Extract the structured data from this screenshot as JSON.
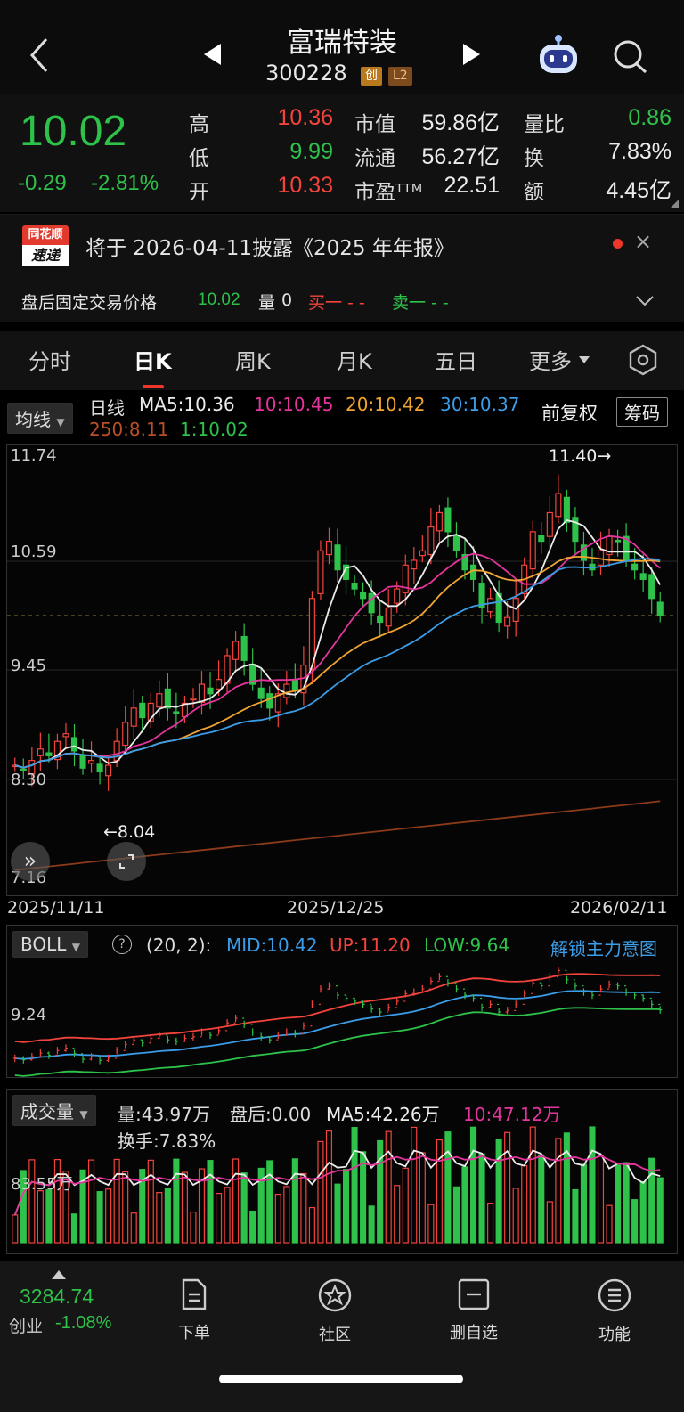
{
  "header": {
    "title": "富瑞特装",
    "code": "300228",
    "badge_board": "创",
    "badge_level": "L2"
  },
  "quote": {
    "price": "10.02",
    "change": "-0.29",
    "change_pct": "-2.81%",
    "high_label": "高",
    "high": "10.36",
    "low_label": "低",
    "low": "9.99",
    "open_label": "开",
    "open": "10.33",
    "mcap_label": "市值",
    "mcap": "59.86亿",
    "float_label": "流通",
    "float": "56.27亿",
    "pe_label": "市盈ᵀᵀᴹ",
    "pe": "22.51",
    "vol_ratio_label": "量比",
    "vol_ratio": "0.86",
    "turnover_label": "换",
    "turnover": "7.83%",
    "amount_label": "额",
    "amount": "4.45亿"
  },
  "notice": {
    "logo_top": "同花顺",
    "logo_bottom": "速递",
    "text": "将于 2026-04-11披露《2025 年年报》",
    "close": "×"
  },
  "after_hours": {
    "label": "盘后固定交易价格",
    "price": "10.02",
    "vol_label": "量",
    "vol": "0",
    "buy": "买一 - -",
    "sell": "卖一 - -"
  },
  "tabs": [
    "分时",
    "日K",
    "周K",
    "月K",
    "五日",
    "更多"
  ],
  "active_tab": 1,
  "kline": {
    "ma_button": "均线",
    "series_label": "日线",
    "ma5": "MA5:10.36",
    "ma10": "10:10.45",
    "ma20": "20:10.42",
    "ma30": "30:10.37",
    "ma250": "250:8.11",
    "ma1": "1:10.02",
    "adjust": "前复权",
    "chip": "筹码",
    "price_ticks": [
      "11.74",
      "10.59",
      "9.45",
      "8.30",
      "7.16"
    ],
    "high_marker": "11.40→",
    "low_marker": "←8.04",
    "dates": [
      "2025/11/11",
      "2025/12/25",
      "2026/02/11"
    ],
    "colors": {
      "ma5": "#ececec",
      "ma10": "#e4359d",
      "ma20": "#f0a431",
      "ma30": "#3b9de8",
      "ma250": "#8b3a1a",
      "ma1": "#2ec24a"
    }
  },
  "boll": {
    "button": "BOLL",
    "params": "(20, 2):",
    "mid": "MID:10.42",
    "up": "UP:11.20",
    "low": "LOW:9.64",
    "unlock": "解锁主力意图",
    "tick": "9.24"
  },
  "volume": {
    "button": "成交量",
    "vol": "量:43.97万",
    "after": "盘后:0.00",
    "ma5": "MA5:42.26万",
    "ma10": "10:47.12万",
    "turnover": "换手:7.83%",
    "tick": "83.55万"
  },
  "nav": {
    "index_value": "3284.74",
    "index_name": "创业",
    "index_change": "-1.08%",
    "order": "下单",
    "community": "社区",
    "watchlist": "删自选",
    "functions": "功能"
  },
  "chart_data": {
    "type": "candlestick",
    "title": "",
    "ylim": [
      7.16,
      11.74
    ],
    "close_series": [
      8.45,
      8.4,
      8.5,
      8.62,
      8.55,
      8.7,
      8.78,
      8.6,
      8.42,
      8.5,
      8.38,
      8.45,
      8.7,
      8.9,
      9.05,
      8.95,
      9.1,
      9.2,
      9.05,
      9.0,
      9.1,
      9.15,
      9.3,
      9.2,
      9.35,
      9.6,
      9.75,
      9.55,
      9.3,
      9.15,
      9.05,
      9.2,
      9.3,
      9.25,
      9.5,
      10.2,
      10.7,
      10.8,
      10.5,
      10.4,
      10.3,
      10.2,
      10.05,
      9.95,
      10.1,
      10.3,
      10.55,
      10.6,
      10.7,
      10.95,
      11.1,
      10.9,
      10.7,
      10.5,
      10.4,
      10.1,
      10.2,
      9.95,
      10.0,
      10.2,
      10.55,
      10.9,
      10.8,
      11.1,
      11.3,
      11.0,
      10.8,
      10.6,
      10.5,
      10.7,
      10.85,
      10.8,
      10.6,
      10.5,
      10.4,
      10.2,
      10.02
    ]
  }
}
